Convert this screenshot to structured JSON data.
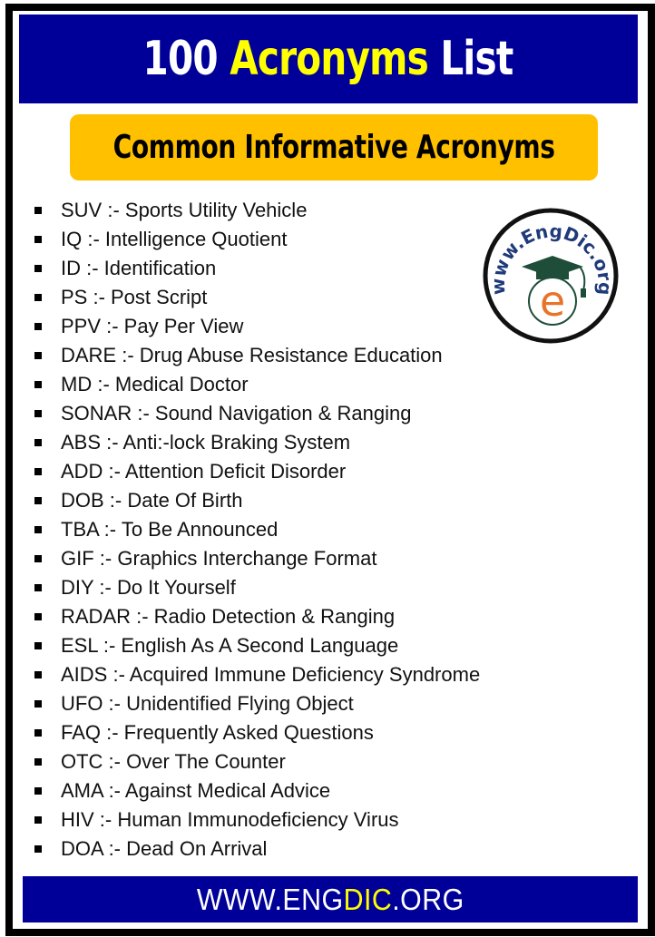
{
  "header": {
    "title_prefix": "100 ",
    "title_accent": "Acronyms",
    "title_suffix": " List"
  },
  "subtitle": "Common Informative Acronyms",
  "logo": {
    "text": "www.EngDic.org",
    "letter": "e"
  },
  "acronyms": [
    "SUV :- Sports Utility Vehicle",
    "IQ :- Intelligence Quotient",
    "ID :- Identification",
    "PS :- Post Script",
    "PPV :- Pay Per View",
    "DARE :- Drug Abuse Resistance Education",
    "MD :- Medical Doctor",
    "SONAR :- Sound Navigation & Ranging",
    "ABS :- Anti:-lock Braking System",
    "ADD :- Attention Deficit Disorder",
    "DOB :- Date Of Birth",
    "TBA :- To Be Announced",
    "GIF :- Graphics Interchange Format",
    "DIY :- Do It Yourself",
    "RADAR :- Radio Detection & Ranging",
    "ESL :- English As A Second Language",
    "AIDS :- Acquired Immune Deficiency Syndrome",
    "UFO :- Unidentified Flying Object",
    "FAQ :- Frequently Asked Questions",
    "OTC :- Over The Counter",
    "AMA :- Against Medical Advice",
    "HIV :- Human Immunodeficiency Virus",
    "DOA :- Dead On Arrival"
  ],
  "footer": {
    "prefix": "WWW.ENG",
    "accent": "DIC",
    "suffix": ".ORG"
  },
  "colors": {
    "navy": "#000099",
    "yellow": "#ffff00",
    "orange": "#ffc000",
    "logo_text": "#1f3a7a",
    "logo_cap": "#1e4d3a",
    "logo_e": "#e8742a"
  }
}
